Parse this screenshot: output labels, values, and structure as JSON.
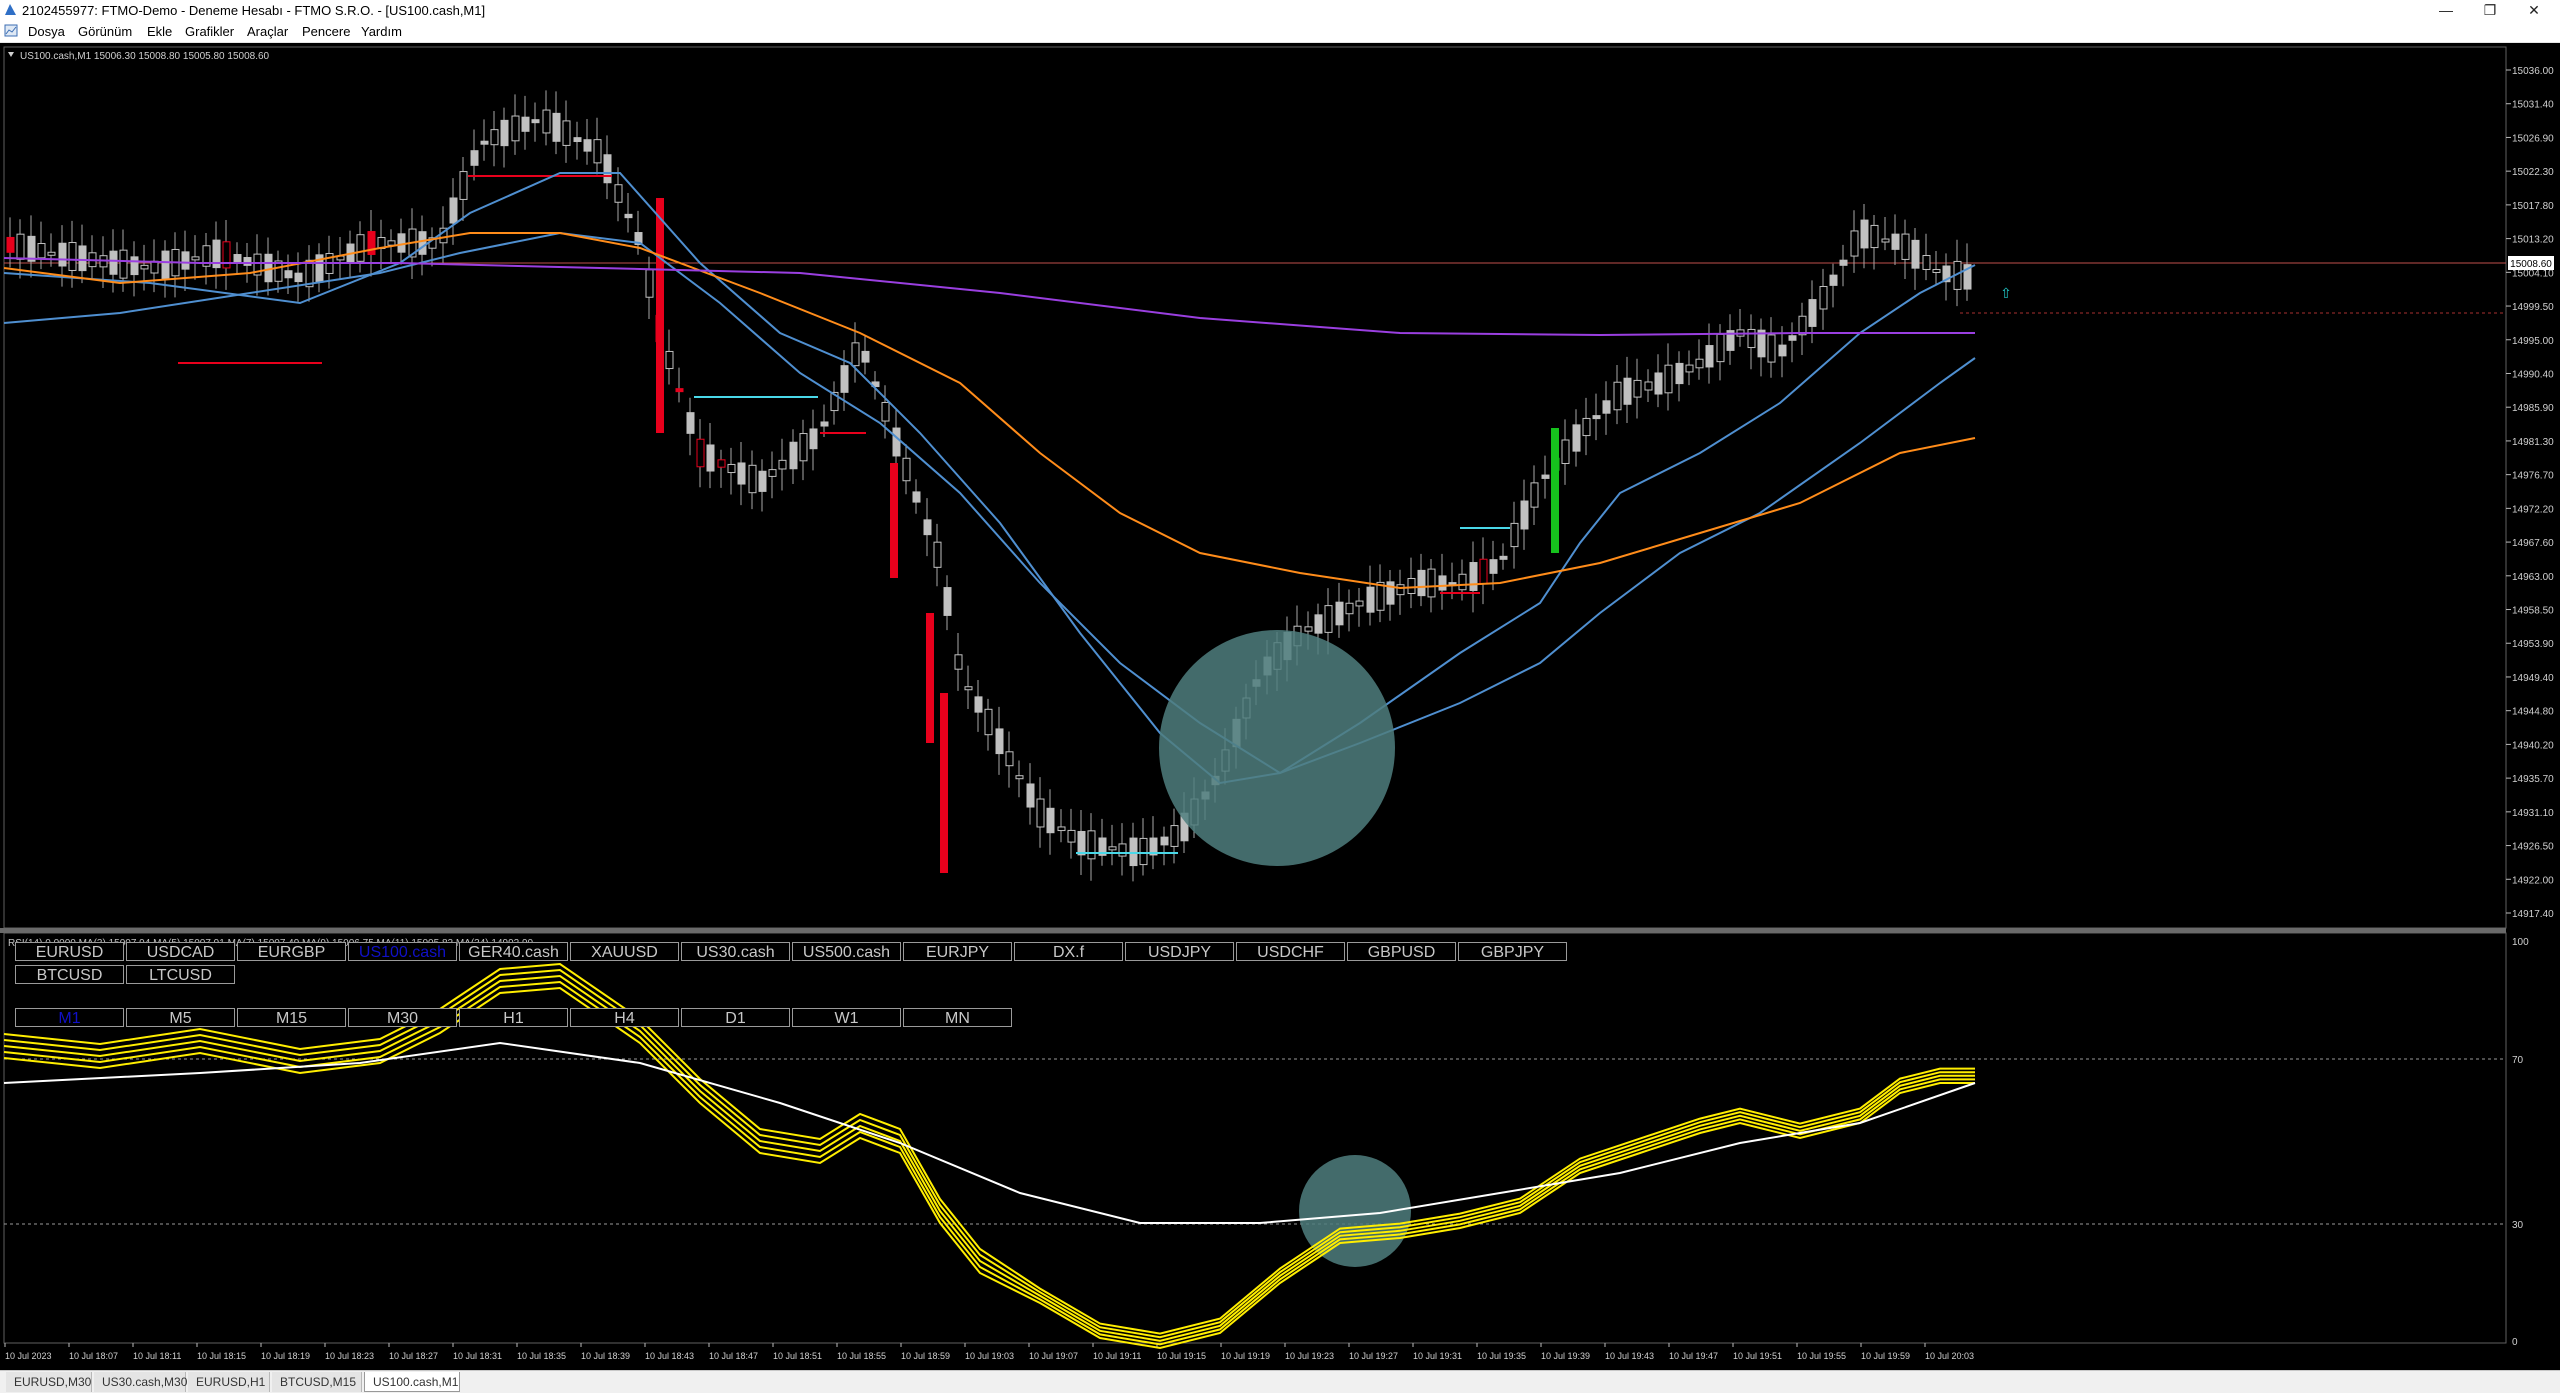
{
  "window": {
    "title": "2102455977: FTMO-Demo - Deneme Hesabı - FTMO S.R.O. - [US100.cash,M1]",
    "controls": [
      "—",
      "❐",
      "✕"
    ]
  },
  "menu": [
    "Dosya",
    "Görünüm",
    "Ekle",
    "Grafikler",
    "Araçlar",
    "Pencere",
    "Yardım"
  ],
  "chart": {
    "header": "US100.cash,M1  15006.30 15008.80 15005.80 15008.60",
    "price_labels": [
      "15036.00",
      "15031.40",
      "15026.90",
      "15022.30",
      "15017.80",
      "15013.20",
      "15004.10",
      "14999.50",
      "14995.00",
      "14990.40",
      "14985.90",
      "14981.30",
      "14976.70",
      "14972.20",
      "14967.60",
      "14963.00",
      "14958.50",
      "14953.90",
      "14949.40",
      "14944.80",
      "14940.20",
      "14935.70",
      "14931.10",
      "14926.50",
      "14922.00",
      "14917.40"
    ],
    "current_price": "15008.60",
    "indicator_header": "RSI(14) 0.0000  MA(3) 15007.94  MA(5) 15007.91  MA(7) 15007.49  MA(9) 15006.75  MA(11) 15005.82  MA(34) 14992.90",
    "rsi_levels": [
      "100",
      "70",
      "30",
      "0"
    ],
    "time_labels": [
      "10 Jul 2023",
      "10 Jul 18:07",
      "10 Jul 18:11",
      "10 Jul 18:15",
      "10 Jul 18:19",
      "10 Jul 18:23",
      "10 Jul 18:27",
      "10 Jul 18:31",
      "10 Jul 18:35",
      "10 Jul 18:39",
      "10 Jul 18:43",
      "10 Jul 18:47",
      "10 Jul 18:51",
      "10 Jul 18:55",
      "10 Jul 18:59",
      "10 Jul 19:03",
      "10 Jul 19:07",
      "10 Jul 19:11",
      "10 Jul 19:15",
      "10 Jul 19:19",
      "10 Jul 19:23",
      "10 Jul 19:27",
      "10 Jul 19:31",
      "10 Jul 19:35",
      "10 Jul 19:39",
      "10 Jul 19:43",
      "10 Jul 19:47",
      "10 Jul 19:51",
      "10 Jul 19:55",
      "10 Jul 19:59",
      "10 Jul 20:03"
    ]
  },
  "symbol_buttons": [
    {
      "label": "EURUSD"
    },
    {
      "label": "USDCAD"
    },
    {
      "label": "EURGBP"
    },
    {
      "label": "US100.cash",
      "active": true
    },
    {
      "label": "GER40.cash"
    },
    {
      "label": "XAUUSD"
    },
    {
      "label": "US30.cash"
    },
    {
      "label": "US500.cash"
    },
    {
      "label": "EURJPY"
    },
    {
      "label": "DX.f"
    },
    {
      "label": "USDJPY"
    },
    {
      "label": "USDCHF"
    },
    {
      "label": "GBPUSD"
    },
    {
      "label": "GBPJPY"
    },
    {
      "label": "BTCUSD"
    },
    {
      "label": "LTCUSD"
    }
  ],
  "timeframe_buttons": [
    {
      "label": "M1",
      "active": true
    },
    {
      "label": "M5"
    },
    {
      "label": "M15"
    },
    {
      "label": "M30"
    },
    {
      "label": "H1"
    },
    {
      "label": "H4"
    },
    {
      "label": "D1"
    },
    {
      "label": "W1"
    },
    {
      "label": "MN"
    }
  ],
  "tabs": [
    {
      "label": "EURUSD,M30"
    },
    {
      "label": "US30.cash,M30"
    },
    {
      "label": "EURUSD,H1"
    },
    {
      "label": "BTCUSD,M15"
    },
    {
      "label": "US100.cash,M1",
      "active": true
    }
  ],
  "colors": {
    "background": "#000000",
    "bull_candle": "#c0c0c0",
    "bear_candle_highlight": "#e8001c",
    "bull_candle_highlight": "#16c21d",
    "ma_fast": "#4f8fd0",
    "ma_slow": "#ff8c1a",
    "ma_long": "#9a3fe0",
    "rsi_fan": "#ffee00",
    "rsi_signal": "#ffffff",
    "highlight_circle": "#4f7e7e"
  }
}
